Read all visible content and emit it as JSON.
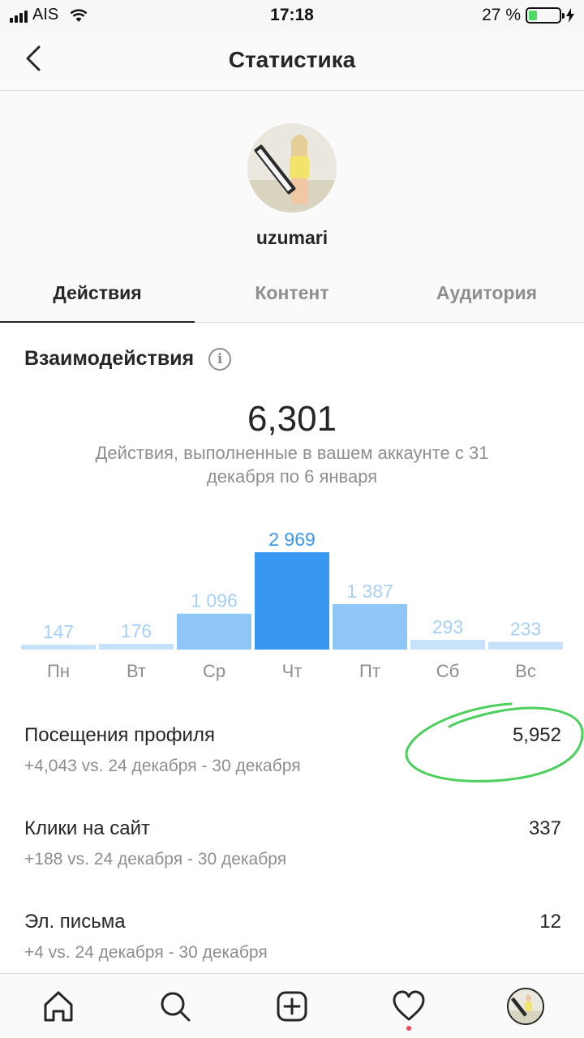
{
  "status_bar": {
    "carrier": "AIS",
    "time": "17:18",
    "battery_text": "27 %",
    "battery_level": 0.27,
    "battery_color": "#4cd964"
  },
  "header": {
    "title": "Статистика",
    "back_icon": "chevron-left-icon"
  },
  "profile": {
    "username": "uzumari"
  },
  "tabs": [
    {
      "label": "Действия",
      "active": true
    },
    {
      "label": "Контент",
      "active": false
    },
    {
      "label": "Аудитория",
      "active": false
    }
  ],
  "interactions": {
    "title": "Взаимодействия",
    "info_icon": "info-icon",
    "total": "6,301",
    "description": "Действия, выполненные в вашем аккаунте с 31 декабря по 6 января"
  },
  "chart_data": {
    "type": "bar",
    "categories": [
      "Пн",
      "Вт",
      "Ср",
      "Чт",
      "Пт",
      "Сб",
      "Вс"
    ],
    "values": [
      147,
      176,
      1096,
      2969,
      1387,
      293,
      233
    ],
    "value_labels": [
      "147",
      "176",
      "1 096",
      "2 969",
      "1 387",
      "293",
      "233"
    ],
    "highlight_index": 3,
    "colors": {
      "highlight": "#3897f0",
      "high": "#8ec6f8",
      "low": "#c6e2fb",
      "highlight_label": "#3897f0",
      "label": "#a5d0f7"
    },
    "title": "",
    "xlabel": "",
    "ylabel": ""
  },
  "metrics": [
    {
      "label": "Посещения профиля",
      "value": "5,952",
      "sub": "+4,043 vs. 24 декабря - 30 декабря"
    },
    {
      "label": "Клики на сайт",
      "value": "337",
      "sub": "+188 vs. 24 декабря - 30 декабря"
    },
    {
      "label": "Эл. письма",
      "value": "12",
      "sub": "+4 vs. 24 декабря - 30 декабря"
    }
  ],
  "annotation_color": "#4ccf5c",
  "bottom_nav": [
    {
      "icon": "home-icon"
    },
    {
      "icon": "search-icon"
    },
    {
      "icon": "add-post-icon"
    },
    {
      "icon": "heart-icon",
      "notification_dot_color": "#ed4956"
    },
    {
      "icon": "profile-avatar-icon"
    }
  ]
}
